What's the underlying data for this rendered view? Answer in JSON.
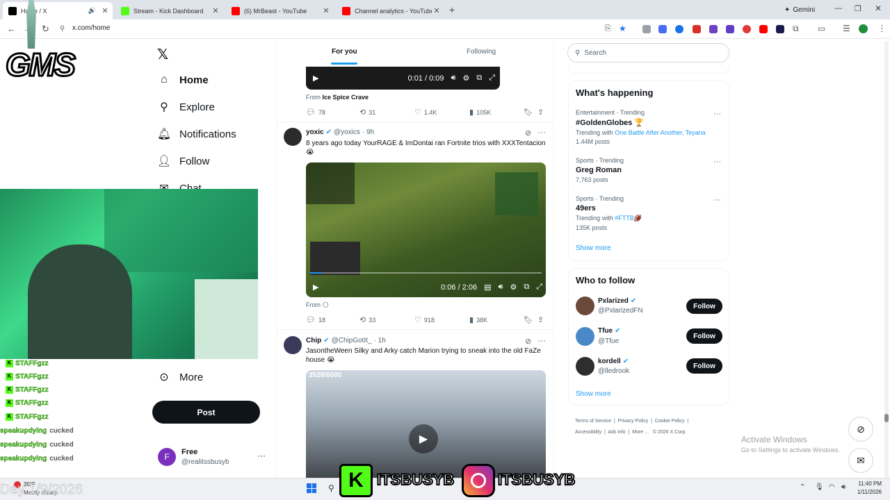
{
  "browser": {
    "tabs": [
      {
        "title": "Home / X",
        "color": "#000000",
        "icon": "x-logo-icon"
      },
      {
        "title": "Stream - Kick Dashboard",
        "color": "#53fc18",
        "icon": "kick-logo-icon"
      },
      {
        "title": "(6) MrBeast - YouTube",
        "color": "#ff0000",
        "icon": "youtube-logo-icon"
      },
      {
        "title": "Channel analytics - YouTube Stu",
        "color": "#ff0000",
        "icon": "youtube-studio-icon"
      }
    ],
    "gemini_label": "Gemini",
    "url": "x.com/home"
  },
  "overlay": {
    "logo_text": "GMS",
    "date_text": "Day 1/9/2026",
    "footer_handle_kick": "ITSBUSYB",
    "footer_handle_ig": "ITSBUSYB",
    "chat": [
      {
        "user": "STAFFgzz",
        "msg": ""
      },
      {
        "user": "STAFFgzz",
        "msg": ""
      },
      {
        "user": "STAFFgzz",
        "msg": ""
      },
      {
        "user": "STAFFgzz",
        "msg": ""
      },
      {
        "user": "STAFFgzz",
        "msg": ""
      },
      {
        "user": "speakupdying",
        "msg": "cucked"
      },
      {
        "user": "speakupdying",
        "msg": "cucked"
      },
      {
        "user": "speakupdying",
        "msg": "cucked"
      }
    ]
  },
  "nav": {
    "items": [
      {
        "label": "Home",
        "icon": "home-icon"
      },
      {
        "label": "Explore",
        "icon": "search-icon"
      },
      {
        "label": "Notifications",
        "icon": "bell-icon"
      },
      {
        "label": "Follow",
        "icon": "add-person-icon"
      },
      {
        "label": "Chat",
        "icon": "chat-icon"
      },
      {
        "label": "More",
        "icon": "more-circle-icon"
      }
    ],
    "post_label": "Post",
    "account": {
      "name": "Free",
      "handle": "@realitssbusyb",
      "initial": "F"
    }
  },
  "feed": {
    "tabs": {
      "for_you": "For you",
      "following": "Following"
    },
    "tweet0": {
      "video_time": "0:01 / 0:09",
      "from_label": "From",
      "from_name": "Ice Spice Crave",
      "replies": "78",
      "reposts": "31",
      "likes": "1.4K",
      "views": "105K"
    },
    "tweet1": {
      "name": "yoxic",
      "handle": "@yoxics",
      "time": "· 9h",
      "text": "8 years ago today YourRAGE & ImDontai ran Fortnite trios with XXXTentacion 😭",
      "video_time": "0:06 / 2:06",
      "from_label": "From",
      "replies": "18",
      "reposts": "33",
      "likes": "918",
      "views": "38K"
    },
    "tweet2": {
      "name": "Chip",
      "handle": "@ChipGotIt_",
      "time": "· 1h",
      "text": "JasontheWeen Silky and Arky catch Marion trying to sneak into the old FaZe house 😭",
      "badge": "3528/6000"
    }
  },
  "sidebar": {
    "search_placeholder": "Search",
    "happening_title": "What's happening",
    "trends": [
      {
        "meta": "Entertainment · Trending",
        "name": "#GoldenGlobes 🏆",
        "with_label": "Trending with",
        "with": "One Battle After Another, Teyana",
        "posts": "1.44M posts"
      },
      {
        "meta": "Sports · Trending",
        "name": "Greg Roman",
        "with_label": "",
        "with": "",
        "posts": "7,763 posts"
      },
      {
        "meta": "Sports · Trending",
        "name": "49ers",
        "with_label": "Trending with",
        "with": "#FTTB🏈",
        "posts": "135K posts"
      }
    ],
    "show_more": "Show more",
    "who_title": "Who to follow",
    "follow": [
      {
        "name": "Pxlarized",
        "handle": "@PxlarizedFN",
        "button": "Follow"
      },
      {
        "name": "Tfue",
        "handle": "@Tfue",
        "button": "Follow"
      },
      {
        "name": "kordell",
        "handle": "@lledrook",
        "button": "Follow"
      }
    ],
    "show_more2": "Show more",
    "footer_links": [
      "Terms of Service",
      "Privacy Policy",
      "Cookie Policy",
      "Accessibility",
      "Ads info",
      "More ...",
      "© 2026 X Corp."
    ]
  },
  "windows": {
    "activate_title": "Activate Windows",
    "activate_sub": "Go to Settings to activate Windows.",
    "weather_temp": "35°F",
    "weather_desc": "Mostly cloudy",
    "clock_time": "11:40 PM",
    "clock_date": "1/11/2026"
  }
}
